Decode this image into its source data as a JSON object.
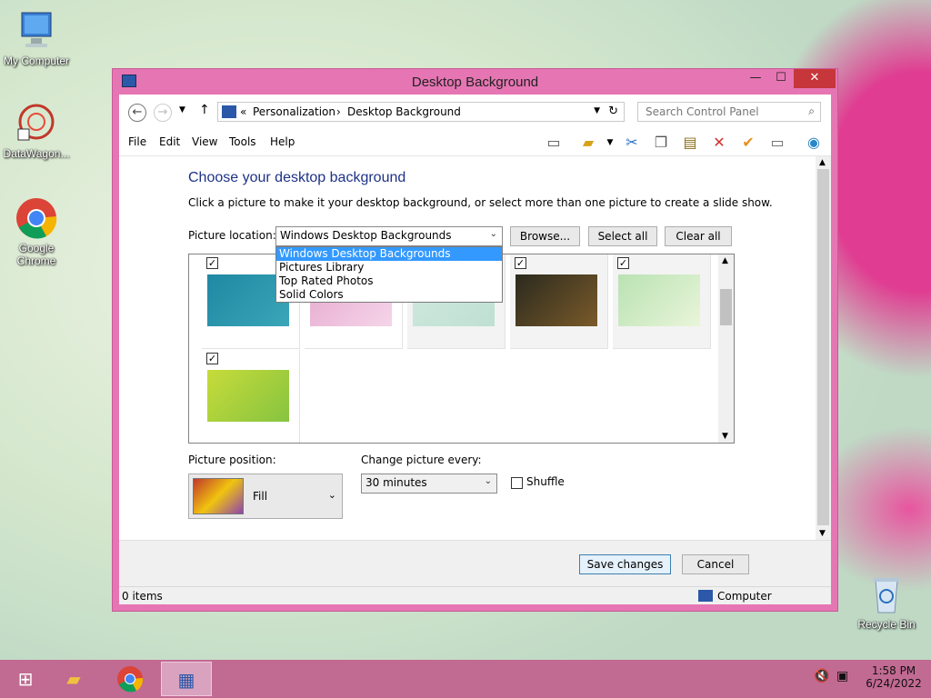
{
  "desktop": {
    "icons": [
      {
        "label": "My Computer"
      },
      {
        "label": "DataWagon..."
      },
      {
        "label": "Google Chrome"
      },
      {
        "label": "Recycle Bin"
      }
    ]
  },
  "window": {
    "title": "Desktop Background",
    "controls": {
      "minimize": "—",
      "maximize": "☐",
      "close": "✕"
    },
    "address": {
      "prefix": "«",
      "crumbs": [
        "Personalization",
        "Desktop Background"
      ],
      "separator": "›"
    },
    "search": {
      "placeholder": "Search Control Panel"
    },
    "menu": [
      "File",
      "Edit",
      "View",
      "Tools",
      "Help"
    ],
    "heading": "Choose your desktop background",
    "subtext": "Click a picture to make it your desktop background, or select more than one picture to create a slide show.",
    "picture_location": {
      "label": "Picture location:",
      "value": "Windows Desktop Backgrounds",
      "options": [
        "Windows Desktop Backgrounds",
        "Pictures Library",
        "Top Rated Photos",
        "Solid Colors"
      ]
    },
    "buttons": {
      "browse": "Browse...",
      "select_all": "Select all",
      "clear_all": "Clear all"
    },
    "pictures": [
      {
        "checked": true,
        "colors": [
          "#1f88a3",
          "#3aa6b8"
        ]
      },
      {
        "checked": true,
        "colors": [
          "#e6a9cf",
          "#f5d5e9"
        ]
      },
      {
        "checked": true,
        "colors": [
          "#cfe8dc",
          "#bfe0d3"
        ]
      },
      {
        "checked": true,
        "colors": [
          "#2b2a1e",
          "#7a5a2a"
        ]
      },
      {
        "checked": true,
        "colors": [
          "#b9e2b3",
          "#e9f5d9"
        ]
      },
      {
        "checked": true,
        "colors": [
          "#c7db3a",
          "#86c440"
        ]
      }
    ],
    "picture_position": {
      "label": "Picture position:",
      "value": "Fill"
    },
    "change_picture": {
      "label": "Change picture every:",
      "value": "30 minutes"
    },
    "shuffle": {
      "label": "Shuffle",
      "checked": false
    },
    "save_label": "Save changes",
    "cancel_label": "Cancel",
    "status": {
      "items": "0 items",
      "location": "Computer"
    }
  },
  "taskbar": {
    "time": "1:58 PM",
    "date": "6/24/2022"
  }
}
